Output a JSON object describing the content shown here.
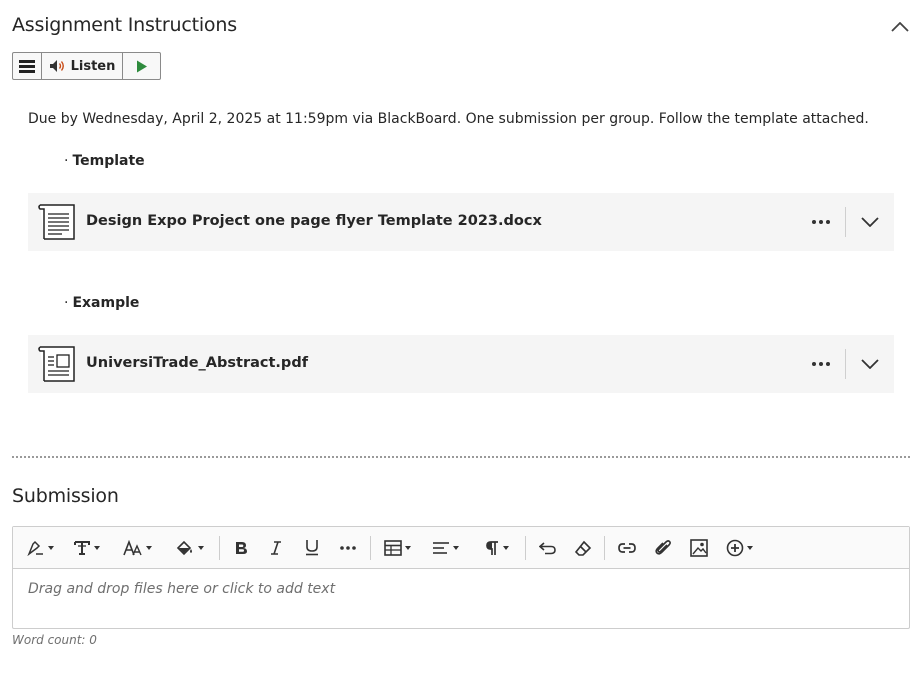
{
  "instructions": {
    "title": "Assignment Instructions",
    "listen_label": "Listen",
    "due_text": "Due by Wednesday, April 2, 2025 at 11:59pm via BlackBoard. One submission per group. Follow the template attached.",
    "sections": [
      {
        "label": "Template",
        "file_name": "Design Expo Project one page flyer Template 2023.docx",
        "file_icon": "document-icon"
      },
      {
        "label": "Example",
        "file_name": "UniversiTrade_Abstract.pdf",
        "file_icon": "pdf-document-icon"
      }
    ]
  },
  "submission": {
    "title": "Submission",
    "editor_placeholder": "Drag and drop files here or click to add text",
    "word_count_label": "Word count: 0"
  },
  "colors": {
    "text": "#262626",
    "card_bg": "#f5f5f5",
    "play_green": "#2e8b3d",
    "muted": "#6f6f6f"
  }
}
